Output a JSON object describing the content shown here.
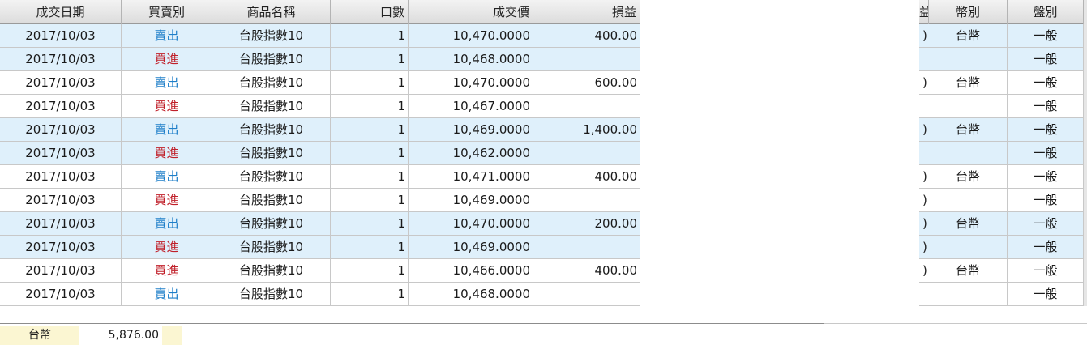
{
  "columns": {
    "date": "成交日期",
    "side": "買賣別",
    "product": "商品名稱",
    "lots": "口數",
    "price": "成交價",
    "pnl": "損益",
    "currency": "幣別",
    "session": "盤別",
    "partial_header_glyph": "益"
  },
  "rows": [
    {
      "date": "2017/10/03",
      "side": "賣出",
      "side_type": "sell",
      "product": "台股指數10",
      "lots": "1",
      "price": "10,470.0000",
      "pnl": "400.00",
      "currency": "台幣",
      "session": "一般",
      "highlight": true,
      "clip": ")"
    },
    {
      "date": "2017/10/03",
      "side": "買進",
      "side_type": "buy",
      "product": "台股指數10",
      "lots": "1",
      "price": "10,468.0000",
      "pnl": "",
      "currency": "",
      "session": "一般",
      "highlight": true,
      "clip": ""
    },
    {
      "date": "2017/10/03",
      "side": "賣出",
      "side_type": "sell",
      "product": "台股指數10",
      "lots": "1",
      "price": "10,470.0000",
      "pnl": "600.00",
      "currency": "台幣",
      "session": "一般",
      "highlight": false,
      "clip": ")"
    },
    {
      "date": "2017/10/03",
      "side": "買進",
      "side_type": "buy",
      "product": "台股指數10",
      "lots": "1",
      "price": "10,467.0000",
      "pnl": "",
      "currency": "",
      "session": "一般",
      "highlight": false,
      "clip": ""
    },
    {
      "date": "2017/10/03",
      "side": "賣出",
      "side_type": "sell",
      "product": "台股指數10",
      "lots": "1",
      "price": "10,469.0000",
      "pnl": "1,400.00",
      "currency": "台幣",
      "session": "一般",
      "highlight": true,
      "clip": ")"
    },
    {
      "date": "2017/10/03",
      "side": "買進",
      "side_type": "buy",
      "product": "台股指數10",
      "lots": "1",
      "price": "10,462.0000",
      "pnl": "",
      "currency": "",
      "session": "一般",
      "highlight": true,
      "clip": ""
    },
    {
      "date": "2017/10/03",
      "side": "賣出",
      "side_type": "sell",
      "product": "台股指數10",
      "lots": "1",
      "price": "10,471.0000",
      "pnl": "400.00",
      "currency": "台幣",
      "session": "一般",
      "highlight": false,
      "clip": ")"
    },
    {
      "date": "2017/10/03",
      "side": "買進",
      "side_type": "buy",
      "product": "台股指數10",
      "lots": "1",
      "price": "10,469.0000",
      "pnl": "",
      "currency": "",
      "session": "一般",
      "highlight": false,
      "clip": ")"
    },
    {
      "date": "2017/10/03",
      "side": "賣出",
      "side_type": "sell",
      "product": "台股指數10",
      "lots": "1",
      "price": "10,470.0000",
      "pnl": "200.00",
      "currency": "台幣",
      "session": "一般",
      "highlight": true,
      "clip": ")"
    },
    {
      "date": "2017/10/03",
      "side": "買進",
      "side_type": "buy",
      "product": "台股指數10",
      "lots": "1",
      "price": "10,469.0000",
      "pnl": "",
      "currency": "",
      "session": "一般",
      "highlight": true,
      "clip": ")"
    },
    {
      "date": "2017/10/03",
      "side": "買進",
      "side_type": "buy",
      "product": "台股指數10",
      "lots": "1",
      "price": "10,466.0000",
      "pnl": "400.00",
      "currency": "台幣",
      "session": "一般",
      "highlight": false,
      "clip": ")"
    },
    {
      "date": "2017/10/03",
      "side": "賣出",
      "side_type": "sell",
      "product": "台股指數10",
      "lots": "1",
      "price": "10,468.0000",
      "pnl": "",
      "currency": "",
      "session": "一般",
      "highlight": false,
      "clip": ""
    }
  ],
  "summary": {
    "currency": "台幣",
    "total": "5,876.00"
  },
  "colors": {
    "sell": "#1f7fc9",
    "buy": "#c0202a",
    "highlight_row": "#dff0fb",
    "summary_bg": "#fbf6d2"
  }
}
